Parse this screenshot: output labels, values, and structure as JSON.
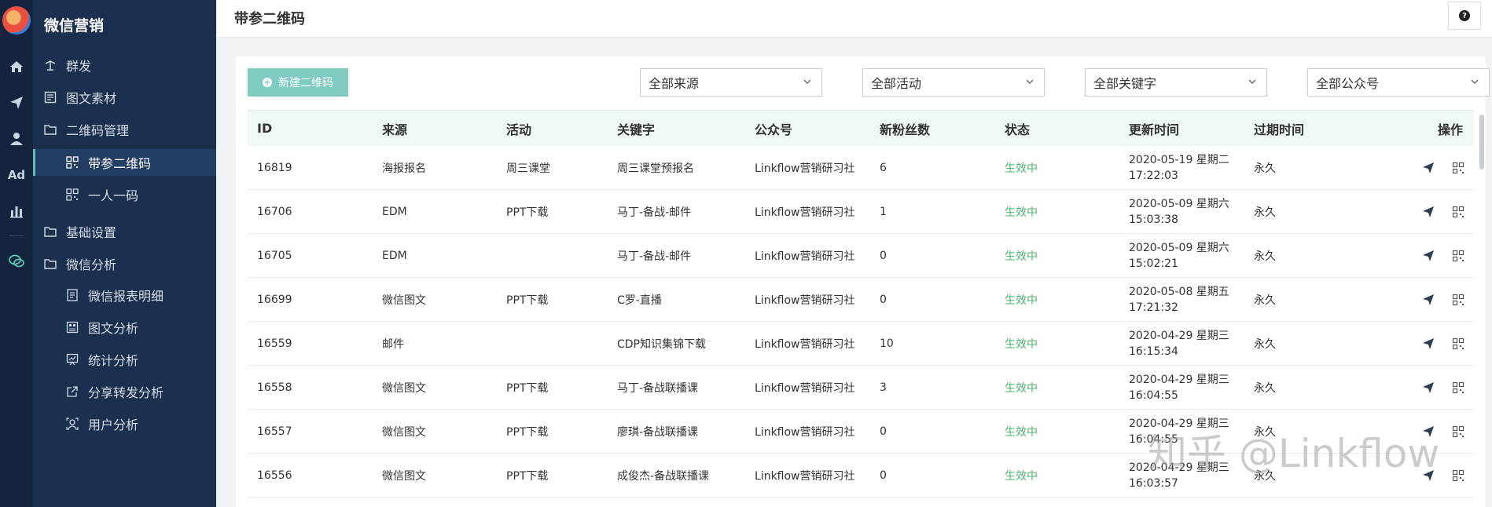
{
  "sidebar": {
    "title": "微信营销",
    "items": [
      {
        "label": "群发",
        "icon": "broadcast-icon"
      },
      {
        "label": "图文素材",
        "icon": "article-icon"
      },
      {
        "label": "二维码管理",
        "icon": "folder-icon"
      },
      {
        "label": "带参二维码",
        "icon": "qrcode-icon"
      },
      {
        "label": "一人一码",
        "icon": "qrcode-icon"
      },
      {
        "label": "基础设置",
        "icon": "folder-icon"
      },
      {
        "label": "微信分析",
        "icon": "folder-icon"
      },
      {
        "label": "微信报表明细",
        "icon": "report-icon"
      },
      {
        "label": "图文分析",
        "icon": "article-analysis-icon"
      },
      {
        "label": "统计分析",
        "icon": "stats-icon"
      },
      {
        "label": "分享转发分析",
        "icon": "share-icon"
      },
      {
        "label": "用户分析",
        "icon": "user-analysis-icon"
      }
    ]
  },
  "rail": {
    "ad_label": "Ad"
  },
  "header": {
    "title": "带参二维码",
    "help": "?"
  },
  "toolbar": {
    "new_button": "新建二维码",
    "filters": [
      "全部来源",
      "全部活动",
      "全部关键字",
      "全部公众号"
    ]
  },
  "table": {
    "columns": [
      "ID",
      "来源",
      "活动",
      "关键字",
      "公众号",
      "新粉丝数",
      "状态",
      "更新时间",
      "过期时间",
      "操作"
    ],
    "rows": [
      {
        "id": "16819",
        "source": "海报报名",
        "activity": "周三课堂",
        "keyword": "周三课堂预报名",
        "account": "Linkflow营销研习社",
        "fans": "6",
        "status": "生效中",
        "date": "2020-05-19 星期二",
        "time": "17:22:03",
        "expire": "永久"
      },
      {
        "id": "16706",
        "source": "EDM",
        "activity": "PPT下载",
        "keyword": "马丁-备战-邮件",
        "account": "Linkflow营销研习社",
        "fans": "1",
        "status": "生效中",
        "date": "2020-05-09 星期六",
        "time": "15:03:38",
        "expire": "永久"
      },
      {
        "id": "16705",
        "source": "EDM",
        "activity": "",
        "keyword": "马丁-备战-邮件",
        "account": "Linkflow营销研习社",
        "fans": "0",
        "status": "生效中",
        "date": "2020-05-09 星期六",
        "time": "15:02:21",
        "expire": "永久"
      },
      {
        "id": "16699",
        "source": "微信图文",
        "activity": "PPT下载",
        "keyword": "C罗-直播",
        "account": "Linkflow营销研习社",
        "fans": "0",
        "status": "生效中",
        "date": "2020-05-08 星期五",
        "time": "17:21:32",
        "expire": "永久"
      },
      {
        "id": "16559",
        "source": "邮件",
        "activity": "",
        "keyword": "CDP知识集锦下载",
        "account": "Linkflow营销研习社",
        "fans": "10",
        "status": "生效中",
        "date": "2020-04-29 星期三",
        "time": "16:15:34",
        "expire": "永久"
      },
      {
        "id": "16558",
        "source": "微信图文",
        "activity": "PPT下载",
        "keyword": "马丁-备战联播课",
        "account": "Linkflow营销研习社",
        "fans": "3",
        "status": "生效中",
        "date": "2020-04-29 星期三",
        "time": "16:04:55",
        "expire": "永久"
      },
      {
        "id": "16557",
        "source": "微信图文",
        "activity": "PPT下载",
        "keyword": "廖琪-备战联播课",
        "account": "Linkflow营销研习社",
        "fans": "0",
        "status": "生效中",
        "date": "2020-04-29 星期三",
        "time": "16:04:55",
        "expire": "永久"
      },
      {
        "id": "16556",
        "source": "微信图文",
        "activity": "PPT下载",
        "keyword": "成俊杰-备战联播课",
        "account": "Linkflow营销研习社",
        "fans": "0",
        "status": "生效中",
        "date": "2020-04-29 星期三",
        "time": "16:03:57",
        "expire": "永久"
      }
    ]
  },
  "watermark": "知乎 @Linkflow",
  "colors": {
    "sidebar": "#1b2f4f",
    "rail": "#14243e",
    "accent": "#7fcbc2",
    "status_active": "#4cb56a"
  }
}
